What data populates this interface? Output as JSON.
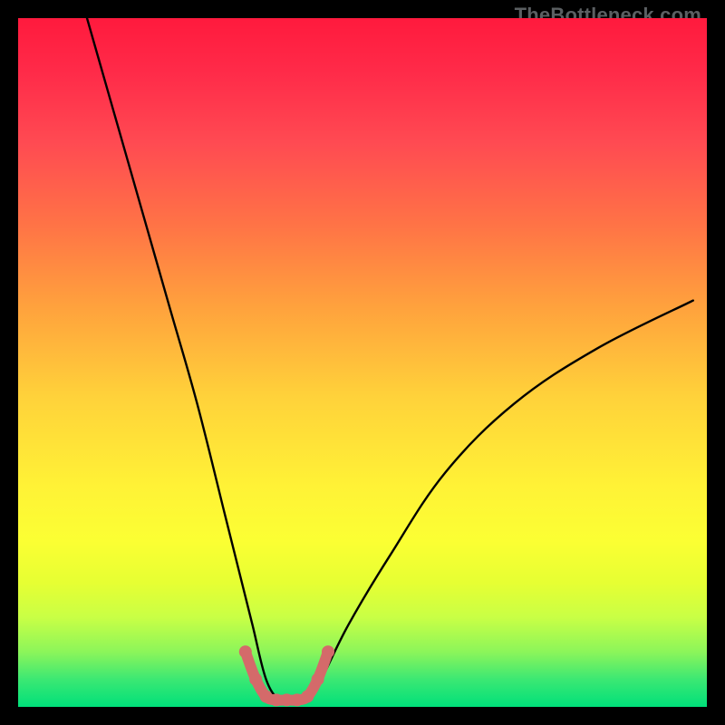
{
  "watermark": "TheBottleneck.com",
  "chart_data": {
    "type": "line",
    "title": "",
    "xlabel": "",
    "ylabel": "",
    "x_range": [
      0,
      100
    ],
    "y_range": [
      0,
      100
    ],
    "series": [
      {
        "name": "bottleneck-curve",
        "color": "#000000",
        "x": [
          10,
          14,
          18,
          22,
          26,
          30,
          32,
          34,
          36,
          38,
          40,
          42,
          44,
          48,
          54,
          62,
          72,
          84,
          98
        ],
        "values": [
          100,
          86,
          72,
          58,
          44,
          28,
          20,
          12,
          4,
          1,
          1,
          1,
          4,
          12,
          22,
          34,
          44,
          52,
          59
        ]
      },
      {
        "name": "optimal-range-marker",
        "color": "#d46a6a",
        "x": [
          33,
          34.5,
          36,
          37.5,
          39,
          40.5,
          42,
          43.5,
          45
        ],
        "values": [
          8,
          4,
          1.5,
          1,
          1,
          1,
          1.5,
          4,
          8
        ]
      }
    ],
    "annotations": []
  }
}
